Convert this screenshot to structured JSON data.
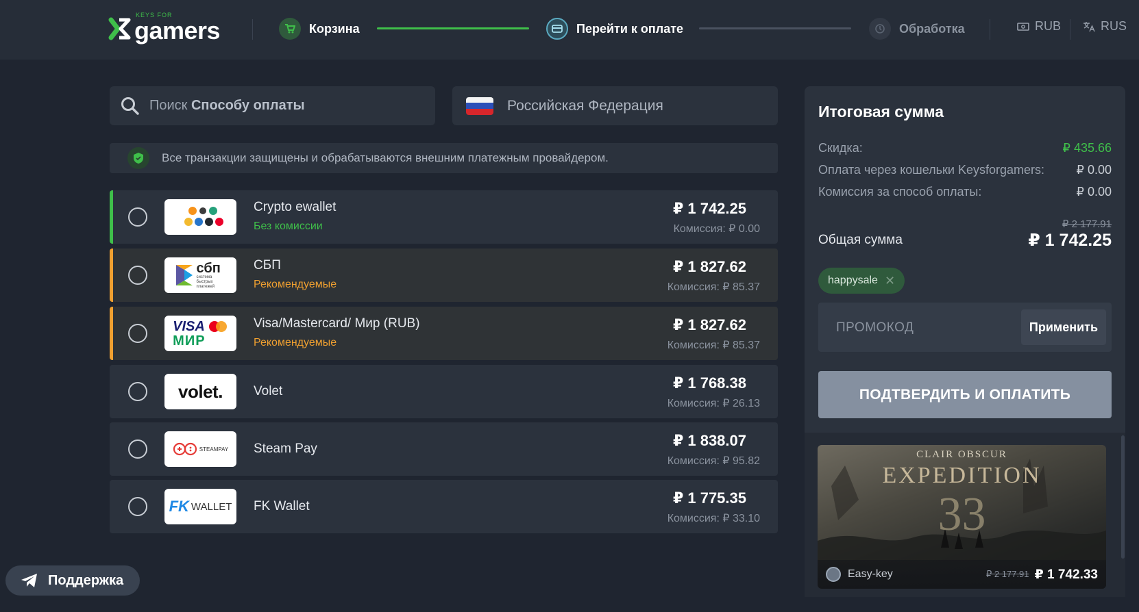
{
  "header": {
    "logo_small": "KEYS FOR",
    "logo_big": "gamers",
    "steps": [
      {
        "label": "Корзина",
        "icon": "cart-icon",
        "state": "done"
      },
      {
        "label": "Перейти к оплате",
        "icon": "card-icon",
        "state": "active"
      },
      {
        "label": "Обработка",
        "icon": "clock-icon",
        "state": "pending"
      }
    ],
    "currency": "RUB",
    "language": "RUS"
  },
  "search": {
    "placeholder_prefix": "Поиск",
    "placeholder_bold": "Способу оплаты"
  },
  "country": {
    "value": "Российская Федерация"
  },
  "secure_note": "Все транзакции защищены и обрабатываются внешним платежным провайдером.",
  "payment_methods": [
    {
      "name": "Crypto ewallet",
      "sub": "Без комиссии",
      "sub_color": "#3fbf4a",
      "accent": "#3fbf4a",
      "price": "₽ 1 742.25",
      "commission": "Комиссия: ₽ 0.00",
      "logo": "crypto-logo"
    },
    {
      "name": "СБП",
      "sub": "Рекомендуемые",
      "sub_color": "#f0a030",
      "accent": "#f0a030",
      "price": "₽ 1 827.62",
      "commission": "Комиссия: ₽ 85.37",
      "logo": "sbp-logo",
      "logo_text": "сбп",
      "logo_sub": "система быстрых платежей"
    },
    {
      "name": "Visa/Mastercard/ Мир (RUB)",
      "sub": "Рекомендуемые",
      "sub_color": "#f0a030",
      "accent": "#f0a030",
      "price": "₽ 1 827.62",
      "commission": "Комиссия: ₽ 85.37",
      "logo": "visa-mir-logo",
      "logo_text": "VISA",
      "logo_text2": "МИР"
    },
    {
      "name": "Volet",
      "sub": "",
      "price": "₽ 1 768.38",
      "commission": "Комиссия: ₽ 26.13",
      "logo": "volet-logo",
      "logo_text": "volet."
    },
    {
      "name": "Steam Pay",
      "sub": "",
      "price": "₽ 1 838.07",
      "commission": "Комиссия: ₽ 95.82",
      "logo": "steampay-logo",
      "logo_text": "STEAMPAY"
    },
    {
      "name": "FK Wallet",
      "sub": "",
      "price": "₽ 1 775.35",
      "commission": "Комиссия: ₽ 33.10",
      "logo": "fkwallet-logo",
      "logo_text": "FK",
      "logo_text2": "WALLET"
    }
  ],
  "summary": {
    "title": "Итоговая сумма",
    "rows": [
      {
        "label": "Скидка:",
        "value": "₽ 435.66"
      },
      {
        "label": "Оплата через кошельки Keysforgamers:",
        "value": "₽ 0.00"
      },
      {
        "label": "Комиссия за способ оплаты:",
        "value": "₽ 0.00"
      }
    ],
    "total_old": "₽ 2 177.91",
    "total_label": "Общая сумма",
    "total_value": "₽ 1 742.25",
    "coupon": "happysale",
    "promo_placeholder": "ПРОМОКОД",
    "apply_label": "Применить",
    "confirm_label": "ПОДТВЕРДИТЬ И ОПЛАТИТЬ"
  },
  "game": {
    "title_small": "CLAIR OBSCUR",
    "title_big": "EXPEDITION",
    "title_num": "33",
    "seller": "Easy-key",
    "old_price": "₽ 2 177.91",
    "price": "₽ 1 742.33"
  },
  "support_label": "Поддержка"
}
